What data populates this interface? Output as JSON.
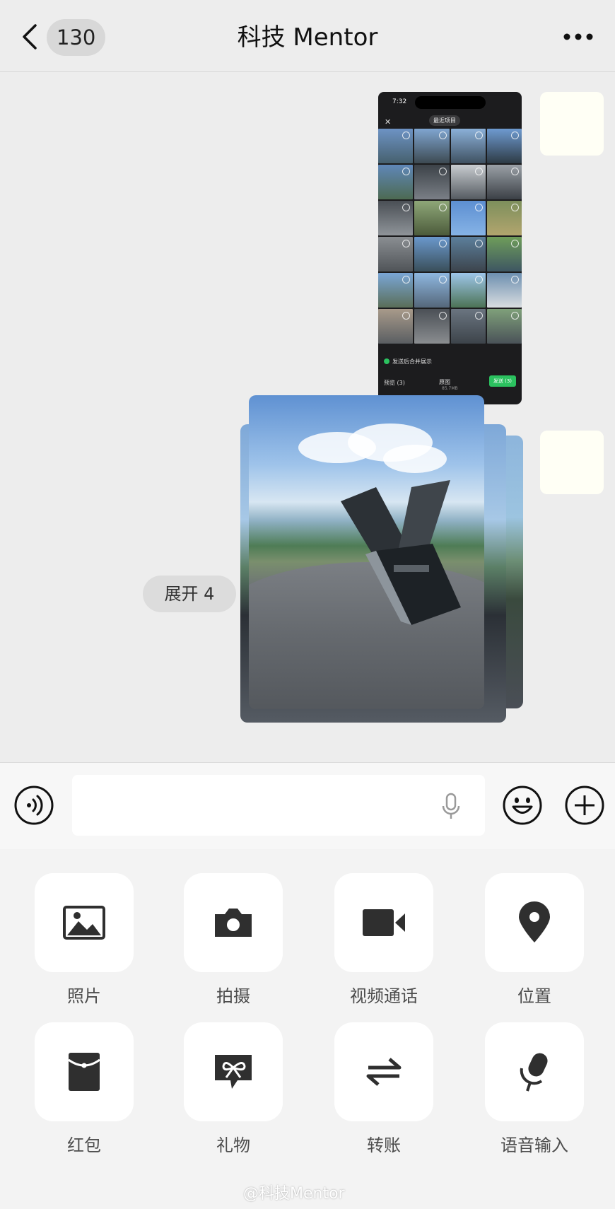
{
  "header": {
    "unread_count": "130",
    "title": "科技 Mentor"
  },
  "chat": {
    "screenshot": {
      "time": "7:32",
      "album": "最近项目",
      "merge_option": "发送后合并展示",
      "preview": "预览 (3)",
      "original": "原图",
      "size": "85.7MB",
      "send": "发送 (3)"
    },
    "expand_label": "展开 4"
  },
  "panel": {
    "items": [
      {
        "label": "照片",
        "icon": "photo-icon"
      },
      {
        "label": "拍摄",
        "icon": "camera-icon"
      },
      {
        "label": "视频通话",
        "icon": "video-call-icon"
      },
      {
        "label": "位置",
        "icon": "location-icon"
      },
      {
        "label": "红包",
        "icon": "red-packet-icon"
      },
      {
        "label": "礼物",
        "icon": "gift-icon"
      },
      {
        "label": "转账",
        "icon": "transfer-icon"
      },
      {
        "label": "语音输入",
        "icon": "voice-input-icon"
      }
    ]
  },
  "watermark": "@科技Mentor"
}
